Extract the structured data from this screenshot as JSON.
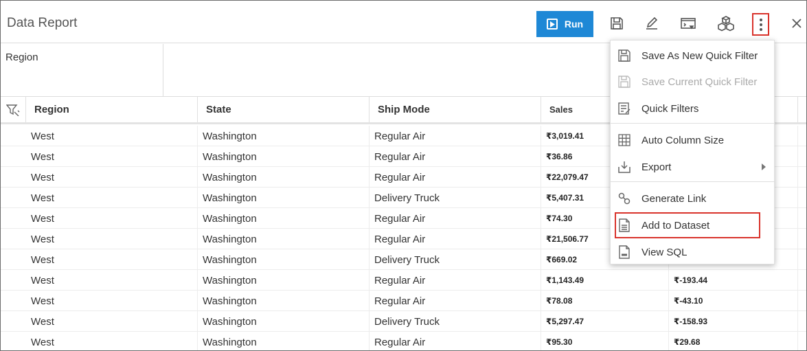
{
  "header": {
    "title": "Data Report",
    "run_label": "Run"
  },
  "filter": {
    "label": "Region"
  },
  "grid": {
    "columns": [
      "Region",
      "State",
      "Ship Mode",
      "Sales"
    ],
    "rows": [
      [
        "West",
        "Washington",
        "Regular Air",
        "₹3,019.41",
        ""
      ],
      [
        "West",
        "Washington",
        "Regular Air",
        "₹36.86",
        ""
      ],
      [
        "West",
        "Washington",
        "Regular Air",
        "₹22,079.47",
        ""
      ],
      [
        "West",
        "Washington",
        "Delivery Truck",
        "₹5,407.31",
        ""
      ],
      [
        "West",
        "Washington",
        "Regular Air",
        "₹74.30",
        ""
      ],
      [
        "West",
        "Washington",
        "Regular Air",
        "₹21,506.77",
        ""
      ],
      [
        "West",
        "Washington",
        "Delivery Truck",
        "₹669.02",
        ""
      ],
      [
        "West",
        "Washington",
        "Regular Air",
        "₹1,143.49",
        "₹-193.44"
      ],
      [
        "West",
        "Washington",
        "Regular Air",
        "₹78.08",
        "₹-43.10"
      ],
      [
        "West",
        "Washington",
        "Delivery Truck",
        "₹5,297.47",
        "₹-158.93"
      ],
      [
        "West",
        "Washington",
        "Regular Air",
        "₹95.30",
        "₹29.68"
      ]
    ]
  },
  "menu": {
    "items": [
      {
        "label": "Save As New Quick Filter"
      },
      {
        "label": "Save Current Quick Filter"
      },
      {
        "label": "Quick Filters"
      },
      {
        "label": "Auto Column Size"
      },
      {
        "label": "Export"
      },
      {
        "label": "Generate Link"
      },
      {
        "label": "Add to Dataset"
      },
      {
        "label": "View SQL"
      }
    ]
  },
  "colors": {
    "run_button": "#1e88d6",
    "highlight": "#d9322a"
  }
}
